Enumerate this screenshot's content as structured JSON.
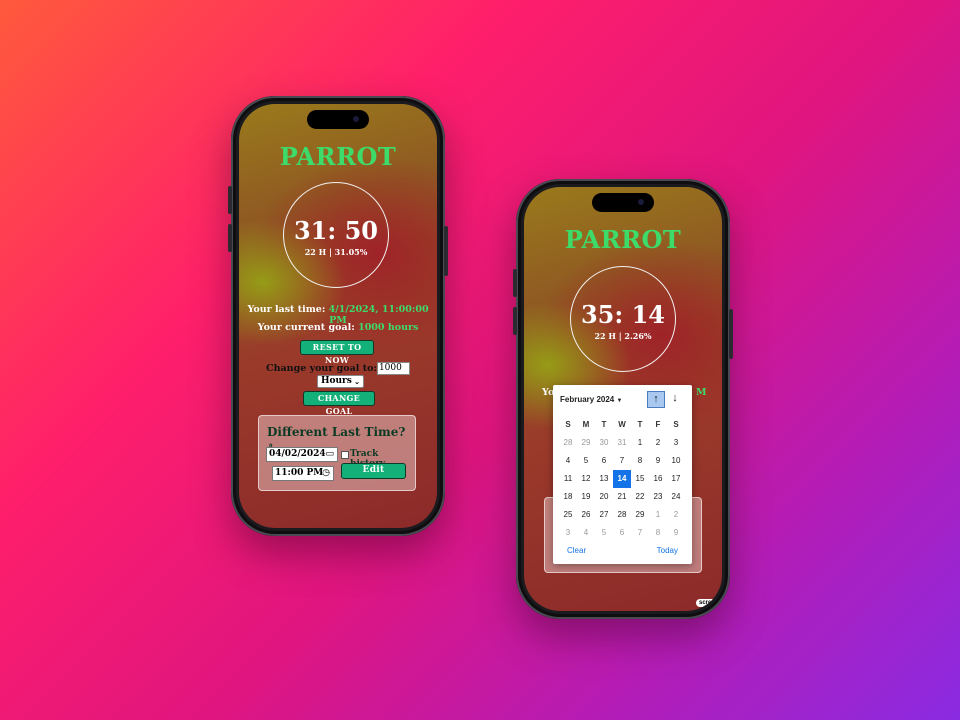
{
  "left_phone": {
    "app_title": "PARROT",
    "timer": "31: 50",
    "timer_sub": "22 H | 31.05%",
    "last_time_label": "Your last time:",
    "last_time_value": "4/1/2024, 11:00:00 PM",
    "goal_label": "Your current goal:",
    "goal_value": "1000 hours",
    "reset_label": "RESET TO NOW",
    "change_goal_prompt": "Change your goal to:",
    "goal_input_value": "1000",
    "unit_select_value": "Hours",
    "change_goal_label": "CHANGE GOAL",
    "panel_title": "Different Last Time?",
    "date_value": "04/02/2024",
    "time_value": "11:00 PM",
    "track_history_label": "Track history",
    "edit_label": "Edit"
  },
  "right_phone": {
    "app_title": "PARROT",
    "timer": "35: 14",
    "timer_sub": "22 H | 2.26%",
    "partial_left": "Yo",
    "partial_right": "M",
    "calendar": {
      "month_label": "February 2024",
      "dow": [
        "S",
        "M",
        "T",
        "W",
        "T",
        "F",
        "S"
      ],
      "weeks": [
        [
          {
            "d": "28",
            "dim": true
          },
          {
            "d": "29",
            "dim": true
          },
          {
            "d": "30",
            "dim": true
          },
          {
            "d": "31",
            "dim": true
          },
          {
            "d": "1"
          },
          {
            "d": "2"
          },
          {
            "d": "3"
          }
        ],
        [
          {
            "d": "4"
          },
          {
            "d": "5"
          },
          {
            "d": "6"
          },
          {
            "d": "7"
          },
          {
            "d": "8"
          },
          {
            "d": "9"
          },
          {
            "d": "10"
          }
        ],
        [
          {
            "d": "11"
          },
          {
            "d": "12"
          },
          {
            "d": "13"
          },
          {
            "d": "14",
            "sel": true
          },
          {
            "d": "15"
          },
          {
            "d": "16"
          },
          {
            "d": "17"
          }
        ],
        [
          {
            "d": "18"
          },
          {
            "d": "19"
          },
          {
            "d": "20"
          },
          {
            "d": "21"
          },
          {
            "d": "22"
          },
          {
            "d": "23"
          },
          {
            "d": "24"
          }
        ],
        [
          {
            "d": "25"
          },
          {
            "d": "26"
          },
          {
            "d": "27"
          },
          {
            "d": "28"
          },
          {
            "d": "29"
          },
          {
            "d": "1",
            "dim": true
          },
          {
            "d": "2",
            "dim": true
          }
        ],
        [
          {
            "d": "3",
            "dim": true
          },
          {
            "d": "4",
            "dim": true
          },
          {
            "d": "5",
            "dim": true
          },
          {
            "d": "6",
            "dim": true
          },
          {
            "d": "7",
            "dim": true
          },
          {
            "d": "8",
            "dim": true
          },
          {
            "d": "9",
            "dim": true
          }
        ]
      ],
      "clear_label": "Clear",
      "today_label": "Today"
    },
    "badge_text": "screen"
  },
  "icons": {
    "prev_month": "arrow-up-icon",
    "next_month": "arrow-down-icon",
    "calendar": "calendar-icon",
    "clock": "clock-icon",
    "sort": "chevron-updown-icon"
  },
  "colors": {
    "accent_green": "#3ddc6a",
    "button_green": "#14b07a",
    "calendar_selected": "#1473e6"
  }
}
